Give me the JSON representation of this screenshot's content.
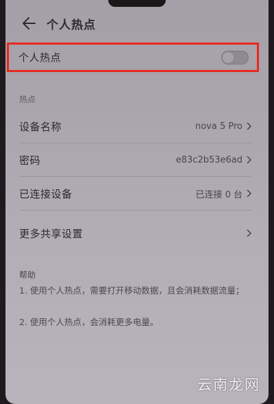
{
  "header": {
    "back_icon": "arrow-left-icon",
    "title": "个人热点"
  },
  "hotspot_toggle": {
    "label": "个人热点",
    "enabled": false,
    "highlight_color": "#e8291e"
  },
  "section": {
    "label": "热点"
  },
  "rows": [
    {
      "label": "设备名称",
      "value": "nova 5 Pro"
    },
    {
      "label": "密码",
      "value": "e83c2b53e6ad"
    },
    {
      "label": "已连接设备",
      "value": "已连接 0 台"
    },
    {
      "label": "更多共享设置",
      "value": ""
    }
  ],
  "help": {
    "title": "帮助",
    "item1": "1. 使用个人热点，需要打开移动数据，且会消耗数据流量；",
    "item2": "2. 使用个人热点，会消耗更多电量。"
  },
  "watermark": "云南龙网"
}
